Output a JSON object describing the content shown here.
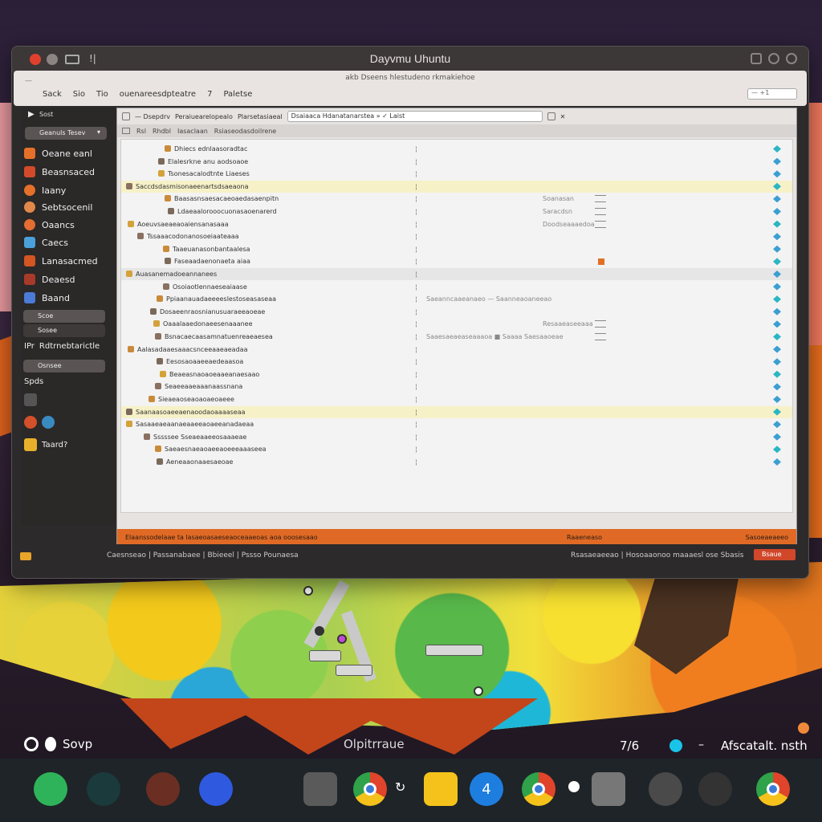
{
  "window": {
    "title": "Dayvmu Uhuntu",
    "title_icon_label": "!|",
    "menu_top_text": "akb Dseens hlestudeno rkmakiehoe",
    "menu_handle": "—",
    "menu_items": [
      "Sack",
      "Sio",
      "Tio",
      "ouenareesdpteatre",
      "7",
      "Paletse"
    ],
    "menu_search": "— +1"
  },
  "sidebar": {
    "header": "Sost",
    "select_label": "Geanuls Tesev",
    "items": [
      {
        "label": "Oeane eanl",
        "icon_color": "#e5702a"
      },
      {
        "label": "Beasnsaced",
        "icon_color": "#d24a2a"
      },
      {
        "label": "Iaany",
        "icon_color": "#e5702a"
      },
      {
        "label": "Sebtsocenil",
        "icon_color": "#e2884a"
      },
      {
        "label": "Oaancs",
        "icon_color": "#e46d32"
      },
      {
        "label": "Caecs",
        "icon_color": "#4aa0d8"
      },
      {
        "label": "Lanasacmed",
        "icon_color": "#d25522"
      },
      {
        "label": "Deaesd",
        "icon_color": "#a83a2a"
      },
      {
        "label": "Baand",
        "icon_color": "#4b7bd6"
      }
    ],
    "pill_1": "Scoe",
    "pill_2": "Sosee",
    "item_special": "Rdtrnebtarictle",
    "item_special_badge": "IPr",
    "pill_3": "Osnsee",
    "small_1": "Spds",
    "small_2": "Taard?"
  },
  "toolbar": {
    "icons_label": "— Dsepdrv",
    "text": "Peraiuearelopealo",
    "breadcrumb": "Plarsetasiaeal",
    "address": "Dsaiaaca Hdanatanarstea »  ✓ Laist",
    "close_glyph": "✕"
  },
  "pathbar": {
    "items": [
      "Rsl",
      "Rhdbl",
      "Iasaclaan",
      "Rsiaseodasdoilrene"
    ]
  },
  "rows": [
    {
      "name": "Dhiecs ednlaasoradtac",
      "indent": 66
    },
    {
      "name": "Elalesrkne anu aodsoaoe",
      "indent": 58
    },
    {
      "name": "Tsonesacalodtnte Liaeses",
      "indent": 58
    },
    {
      "name": "Saccdsdasmisonaeenartsdsaeaona",
      "indent": 18,
      "highlight": "yellow"
    },
    {
      "name": "Baasasnsaesacaeoaedasaenpitn",
      "indent": 66,
      "mid": "Soanasan",
      "box": true
    },
    {
      "name": "Ldaeaalorooocuonasaoenarerd",
      "indent": 70,
      "mid": "Saracdsn",
      "box": true
    },
    {
      "name": "Aoeuvsaeaeaoaiensanasaaa",
      "indent": 20,
      "mid": "Doodseaaaedoa",
      "box": true
    },
    {
      "name": "Tssaaacodonanosoeiaateaaa",
      "indent": 32
    },
    {
      "name": "Taaeuanasonbantaalesa",
      "indent": 64
    },
    {
      "name": "Faseaadaenonaeta aiaa",
      "indent": 66,
      "orange": true
    },
    {
      "name": "Auasanemadoeannanees",
      "indent": 18,
      "highlight": "gray"
    },
    {
      "name": "Osoiaotlennaeseaiaase",
      "indent": 64
    },
    {
      "name": "Ppiaanauadaeeeeslestoseasaseaa",
      "indent": 56,
      "mid": "Saeanncaaeanaeo  —  Saanneaoaneeao"
    },
    {
      "name": "Dosaeenraosnianusuaraeeaoeae",
      "indent": 48
    },
    {
      "name": "Oaaalaaedonaeesenaaanee",
      "indent": 52,
      "mid": "Resaaeaseeaaa",
      "box": true
    },
    {
      "name": "Bsnacaecaasamnatuenreaeaesea",
      "indent": 54,
      "mid": "Saaesaeaeaseaaaoa  ■  Saaaa  Saesaaoeae",
      "box": true
    },
    {
      "name": "Aalasadaaesaaacsnceeaaeaeadaa",
      "indent": 20
    },
    {
      "name": "Eesosaoaaeeaedeaasoa",
      "indent": 56
    },
    {
      "name": "Beaeasnaoaoeaaeanaesaao",
      "indent": 60
    },
    {
      "name": "Seaeeaaeaaanaassnana",
      "indent": 54
    },
    {
      "name": "Sieaeaoseaoaoaeoaeee",
      "indent": 46
    },
    {
      "name": "Saanaasoaeeaenaoodaoaaaaseaa",
      "indent": 18,
      "highlight": "yellow"
    },
    {
      "name": "Sasaaeaeaanaeaaeeaoaeeanadaeaa",
      "indent": 18
    },
    {
      "name": "Sssssee  Sseaeaaeeosaaaeae",
      "indent": 40
    },
    {
      "name": "Saeaesnaeaoaeeaoeeeaaaseea",
      "indent": 54
    },
    {
      "name": "Aeneaaonaaesaeoae",
      "indent": 56
    }
  ],
  "statusbar": {
    "left": "Elaanssodelaae ta lasaeoasaeseaoceaaeoas aoa ooosesaao",
    "mid": "Raaeneaso",
    "right": "Sasoeaeaeeo"
  },
  "footer": {
    "left": "Caesnseao  |  Passanabaee  |  Bbieeel  |  Pssso  Pounaesa",
    "right": "Rsasaeaeeao  |  Hosoaaonoo  maaaesl  ose  Sbasis",
    "button": "Bsaue"
  },
  "desktop": {
    "left_label": "Sovp",
    "center_label": "Olpitrraue",
    "time": "7/6",
    "dash": "–",
    "right_label": "Afscatalt. nsth"
  },
  "dock": {
    "apps": [
      {
        "name": "phone-app",
        "color": "#2fb35a"
      },
      {
        "name": "eye-app",
        "color": "#1b3a3c"
      },
      {
        "name": "record-app",
        "color": "#6b2e22"
      },
      {
        "name": "chat-app",
        "color": "#2f5ae0"
      },
      {
        "name": "photos-app",
        "color": "#5a5a5a"
      },
      {
        "name": "chrome-app-1",
        "color": "#e0522a"
      },
      {
        "name": "notes-app",
        "color": "#f5c21b"
      },
      {
        "name": "number-app",
        "color": "#1e7ee0"
      },
      {
        "name": "chrome-app-2",
        "color": "#e0522a"
      },
      {
        "name": "settings-app",
        "color": "#777"
      },
      {
        "name": "terminal-app",
        "color": "#4a4a4a"
      },
      {
        "name": "camera-app",
        "color": "#333"
      },
      {
        "name": "chrome-app-3",
        "color": "#e0522a"
      }
    ],
    "number_glyph": "4"
  }
}
